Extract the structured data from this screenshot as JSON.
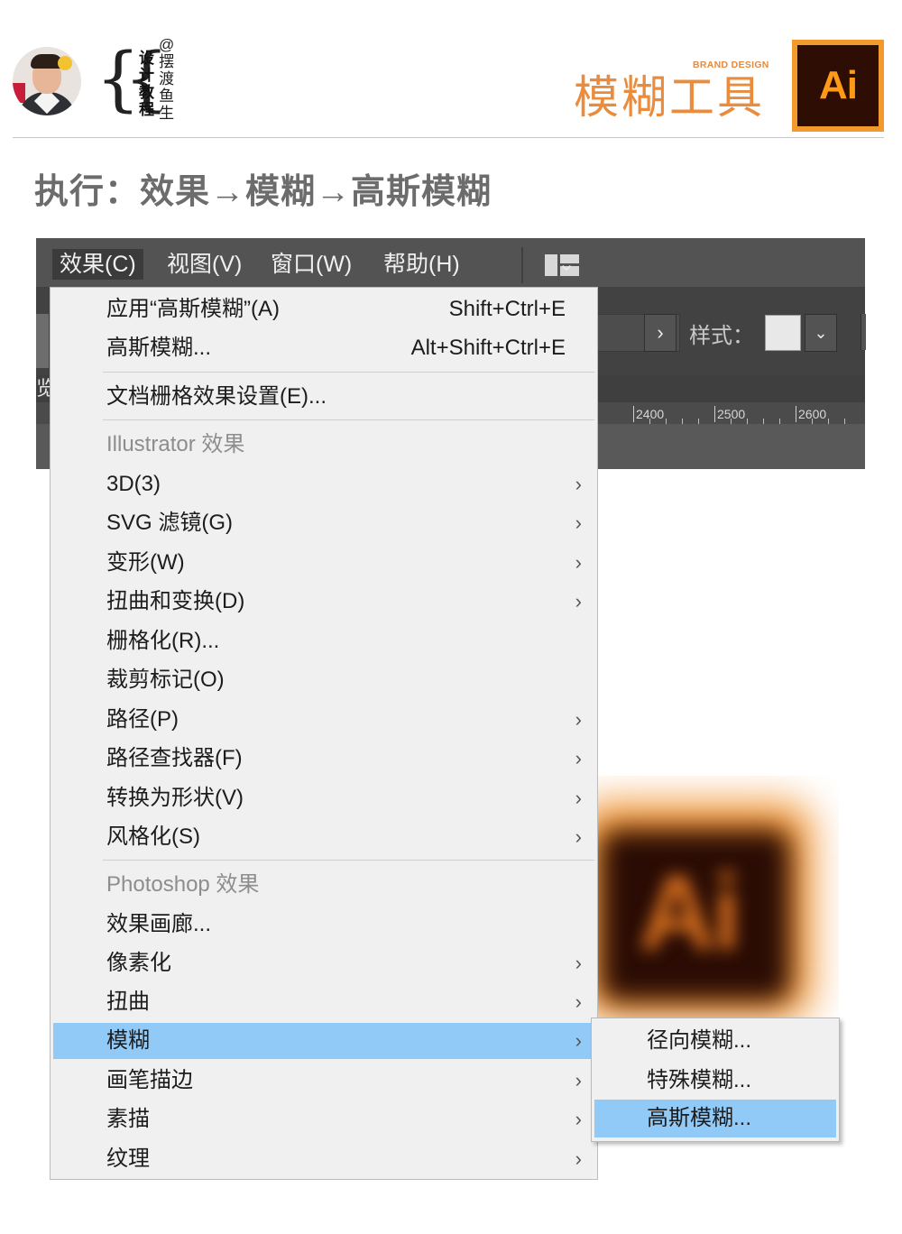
{
  "header": {
    "author_vertical_bold": [
      "设",
      "计",
      "教",
      "程"
    ],
    "author_vertical_light": [
      "@",
      "摆",
      "渡",
      "鱼",
      "生"
    ],
    "brand_small": "BRAND DESIGN",
    "brand_title": "模糊工具",
    "logo_text": "Ai"
  },
  "step_title": "执行：效果→模糊→高斯模糊",
  "menubar": {
    "items": [
      "效果(C)",
      "视图(V)",
      "窗口(W)",
      "帮助(H)"
    ],
    "active_index": 0
  },
  "control_bar": {
    "style_label": "样式：",
    "tab_glyph": "览"
  },
  "ruler": {
    "labels": [
      "2400",
      "2500",
      "2600"
    ]
  },
  "dropdown": {
    "apply_last": {
      "label": "应用“高斯模糊”(A)",
      "shortcut": "Shift+Ctrl+E"
    },
    "last_effect": {
      "label": "高斯模糊...",
      "shortcut": "Alt+Shift+Ctrl+E"
    },
    "doc_raster": {
      "label": "文档栅格效果设置(E)..."
    },
    "illustrator_header": "Illustrator 效果",
    "illustrator_items": [
      {
        "label": "3D(3)",
        "has_submenu": true
      },
      {
        "label": "SVG 滤镜(G)",
        "has_submenu": true
      },
      {
        "label": "变形(W)",
        "has_submenu": true
      },
      {
        "label": "扭曲和变换(D)",
        "has_submenu": true
      },
      {
        "label": "栅格化(R)...",
        "has_submenu": false
      },
      {
        "label": "裁剪标记(O)",
        "has_submenu": false
      },
      {
        "label": "路径(P)",
        "has_submenu": true
      },
      {
        "label": "路径查找器(F)",
        "has_submenu": true
      },
      {
        "label": "转换为形状(V)",
        "has_submenu": true
      },
      {
        "label": "风格化(S)",
        "has_submenu": true
      }
    ],
    "photoshop_header": "Photoshop 效果",
    "photoshop_items": [
      {
        "label": "效果画廊...",
        "has_submenu": false
      },
      {
        "label": "像素化",
        "has_submenu": true
      },
      {
        "label": "扭曲",
        "has_submenu": true
      },
      {
        "label": "模糊",
        "has_submenu": true,
        "highlighted": true
      },
      {
        "label": "画笔描边",
        "has_submenu": true
      },
      {
        "label": "素描",
        "has_submenu": true
      },
      {
        "label": "纹理",
        "has_submenu": true
      }
    ],
    "submenu_arrow": "›"
  },
  "submenu": {
    "items": [
      {
        "label": "径向模糊..."
      },
      {
        "label": "特殊模糊..."
      },
      {
        "label": "高斯模糊...",
        "highlighted": true
      }
    ]
  },
  "colors": {
    "accent_orange": "#e98c3d",
    "menu_highlight": "#91c9f7",
    "app_dark": "#535353"
  }
}
